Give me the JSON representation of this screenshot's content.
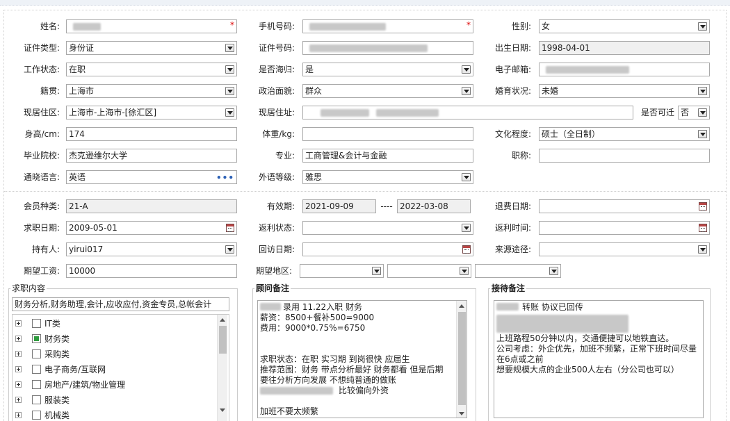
{
  "form": {
    "name": {
      "label": "姓名:",
      "value": "",
      "required": "*"
    },
    "phone": {
      "label": "手机号码:",
      "value": "",
      "required": "*"
    },
    "gender": {
      "label": "性别:",
      "value": "女"
    },
    "id_type": {
      "label": "证件类型:",
      "value": "身份证"
    },
    "id_number": {
      "label": "证件号码:",
      "value": ""
    },
    "birth_date": {
      "label": "出生日期:",
      "value": "1998-04-01"
    },
    "work_status": {
      "label": "工作状态:",
      "value": "在职"
    },
    "overseas": {
      "label": "是否海归:",
      "value": "是"
    },
    "email": {
      "label": "电子邮箱:",
      "value": ""
    },
    "native": {
      "label": "籍贯:",
      "value": "上海市"
    },
    "political": {
      "label": "政治面貌:",
      "value": "群众"
    },
    "marital": {
      "label": "婚育状况:",
      "value": "未婚"
    },
    "residence_area": {
      "label": "现居住区:",
      "value": "上海市-上海市-[徐汇区]"
    },
    "address": {
      "label": "现居住址:",
      "value": ""
    },
    "relocate": {
      "label": "是否可迁",
      "value": "否"
    },
    "height": {
      "label": "身高/cm:",
      "value": "174"
    },
    "weight": {
      "label": "体重/kg:",
      "value": ""
    },
    "education": {
      "label": "文化程度:",
      "value": "硕士（全日制）"
    },
    "school": {
      "label": "毕业院校:",
      "value": "杰克逊维尔大学"
    },
    "major": {
      "label": "专业:",
      "value": "工商管理&会计与金融"
    },
    "title": {
      "label": "职称:",
      "value": ""
    },
    "language": {
      "label": "通晓语言:",
      "value": "英语",
      "more": "•••"
    },
    "foreign_level": {
      "label": "外语等级:",
      "value": "雅思"
    }
  },
  "membership": {
    "type": {
      "label": "会员种类:",
      "value": "21-A"
    },
    "validity": {
      "label": "有效期:",
      "from": "2021-09-09",
      "sep": "----",
      "to": "2022-03-08"
    },
    "refund_date": {
      "label": "退费日期:",
      "value": ""
    },
    "apply_date": {
      "label": "求职日期:",
      "value": "2009-05-01"
    },
    "rebate_status": {
      "label": "返利状态:",
      "value": ""
    },
    "rebate_time": {
      "label": "返利时间:",
      "value": ""
    },
    "holder": {
      "label": "持有人:",
      "value": "yirui017"
    },
    "visit_date": {
      "label": "回访日期:",
      "value": ""
    },
    "source": {
      "label": "来源途径:",
      "value": ""
    },
    "salary": {
      "label": "期望工资:",
      "value": "10000"
    },
    "region": {
      "label": "期望地区:",
      "v1": "",
      "v2": "",
      "v3": ""
    }
  },
  "job": {
    "title": "求职内容",
    "summary": "财务分析,财务助理,会计,应收应付,资金专员,总帐会计",
    "tree": [
      {
        "label": "IT类",
        "checked": false
      },
      {
        "label": "财务类",
        "checked": true
      },
      {
        "label": "采购类",
        "checked": false
      },
      {
        "label": "电子商务/互联网",
        "checked": false
      },
      {
        "label": "房地产/建筑/物业管理",
        "checked": false
      },
      {
        "label": "服装类",
        "checked": false
      },
      {
        "label": "机械类",
        "checked": false
      }
    ]
  },
  "consultant": {
    "title": "顾问备注",
    "lines": [
      "录用   11.22入职   财务",
      "薪资：8500+餐补500=9000",
      "费用：9000*0.75%=6750",
      "",
      "",
      "求职状态：在职   实习期  到岗很快   应届生",
      "推荐范围：财务  带点分析最好  财务都看  但是后期",
      "要往分析方向发展  不想纯普通的做账",
      "比较偏向外资",
      "",
      "加班不要太频繁"
    ]
  },
  "reception": {
    "title": "接待备注",
    "lines": [
      "转账  协议已回传",
      "",
      "",
      "上班路程50分钟以内，交通便捷可以地铁直达。",
      "公司考虑：外企优先，加班不频繁，正常下班时间尽量",
      "在6点或之前",
      "想要规模大点的企业500人左右（分公司也可以）"
    ]
  }
}
